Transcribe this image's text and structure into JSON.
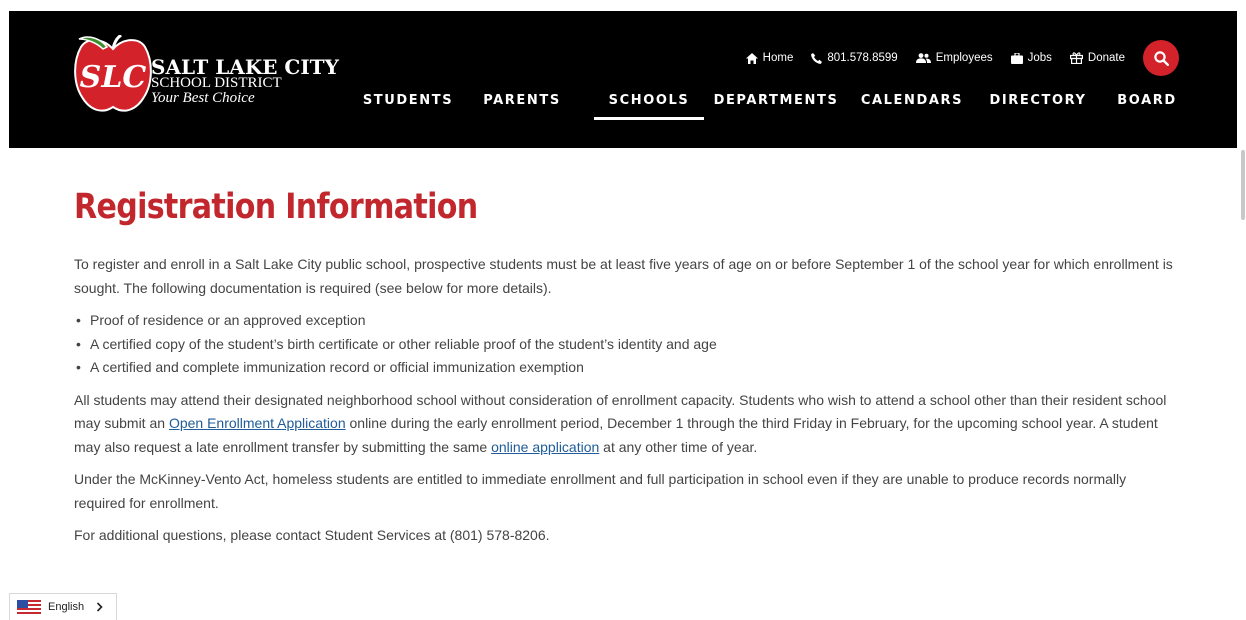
{
  "colors": {
    "accent_red": "#c1272d",
    "header_bg": "#000000",
    "link": "#1f5c99",
    "search_bg": "#d3222a"
  },
  "logo": {
    "name": "SALT LAKE CITY",
    "subtitle": "SCHOOL DISTRICT",
    "tagline": "Your Best Choice",
    "icon": "apple-logo-icon"
  },
  "utility_nav": [
    {
      "label": "Home",
      "icon": "home-icon"
    },
    {
      "label": "801.578.8599",
      "icon": "phone-icon"
    },
    {
      "label": "Employees",
      "icon": "users-icon"
    },
    {
      "label": "Jobs",
      "icon": "briefcase-icon"
    },
    {
      "label": "Donate",
      "icon": "gift-icon"
    }
  ],
  "search": {
    "icon": "search-icon"
  },
  "main_nav": [
    {
      "label": "STUDENTS",
      "active": false
    },
    {
      "label": "PARENTS",
      "active": false
    },
    {
      "label": "SCHOOLS",
      "active": true
    },
    {
      "label": "DEPARTMENTS",
      "active": false
    },
    {
      "label": "CALENDARS",
      "active": false
    },
    {
      "label": "DIRECTORY",
      "active": false
    },
    {
      "label": "BOARD",
      "active": false
    }
  ],
  "page": {
    "title": "Registration Information",
    "intro": "To register and enroll in a Salt Lake City public school, prospective students must be at least five years of age on or before September 1 of the school year for which enrollment is sought. The following documentation is required (see below for more details).",
    "requirements": [
      "Proof of residence or an approved exception",
      "A certified copy of the student’s birth certificate or other reliable proof of the student’s identity and age",
      "A certified and complete immunization record or official immunization exemption"
    ],
    "enrollment": {
      "part1": "All students may attend their designated neighborhood school without consideration of enrollment capacity. Students who wish to attend a school other than their resident school may submit an ",
      "link1": "Open Enrollment Application",
      "part2": " online during the early enrollment period, December 1 through the third Friday in February, for the upcoming school year. A student may also request a late enrollment transfer by submitting the same ",
      "link2": "online application",
      "part3": " at any other time of year."
    },
    "mckinney": "Under the McKinney-Vento Act, homeless students are entitled to immediate enrollment and full participation in school even if they are unable to produce records normally required for enrollment.",
    "contact": "For additional questions, please contact Student Services at (801) 578-8206."
  },
  "language": {
    "label": "English",
    "flag": "us-flag-icon",
    "chevron": "chevron-right-icon"
  }
}
